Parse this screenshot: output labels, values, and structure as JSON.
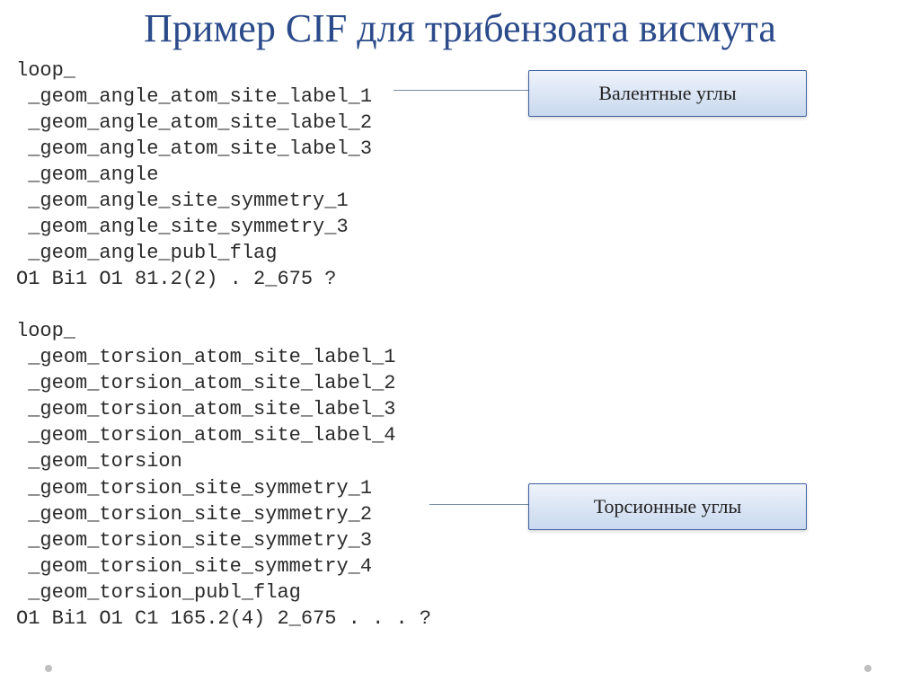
{
  "title": "Пример CIF для трибензоата висмута",
  "code": "loop_\n _geom_angle_atom_site_label_1\n _geom_angle_atom_site_label_2\n _geom_angle_atom_site_label_3\n _geom_angle\n _geom_angle_site_symmetry_1\n _geom_angle_site_symmetry_3\n _geom_angle_publ_flag\nO1 Bi1 O1 81.2(2) . 2_675 ?\n\nloop_\n _geom_torsion_atom_site_label_1\n _geom_torsion_atom_site_label_2\n _geom_torsion_atom_site_label_3\n _geom_torsion_atom_site_label_4\n _geom_torsion\n _geom_torsion_site_symmetry_1\n _geom_torsion_site_symmetry_2\n _geom_torsion_site_symmetry_3\n _geom_torsion_site_symmetry_4\n _geom_torsion_publ_flag\nO1 Bi1 O1 C1 165.2(4) 2_675 . . . ?",
  "callouts": {
    "angles": "Валентные углы",
    "torsion": "Торсионные углы"
  }
}
